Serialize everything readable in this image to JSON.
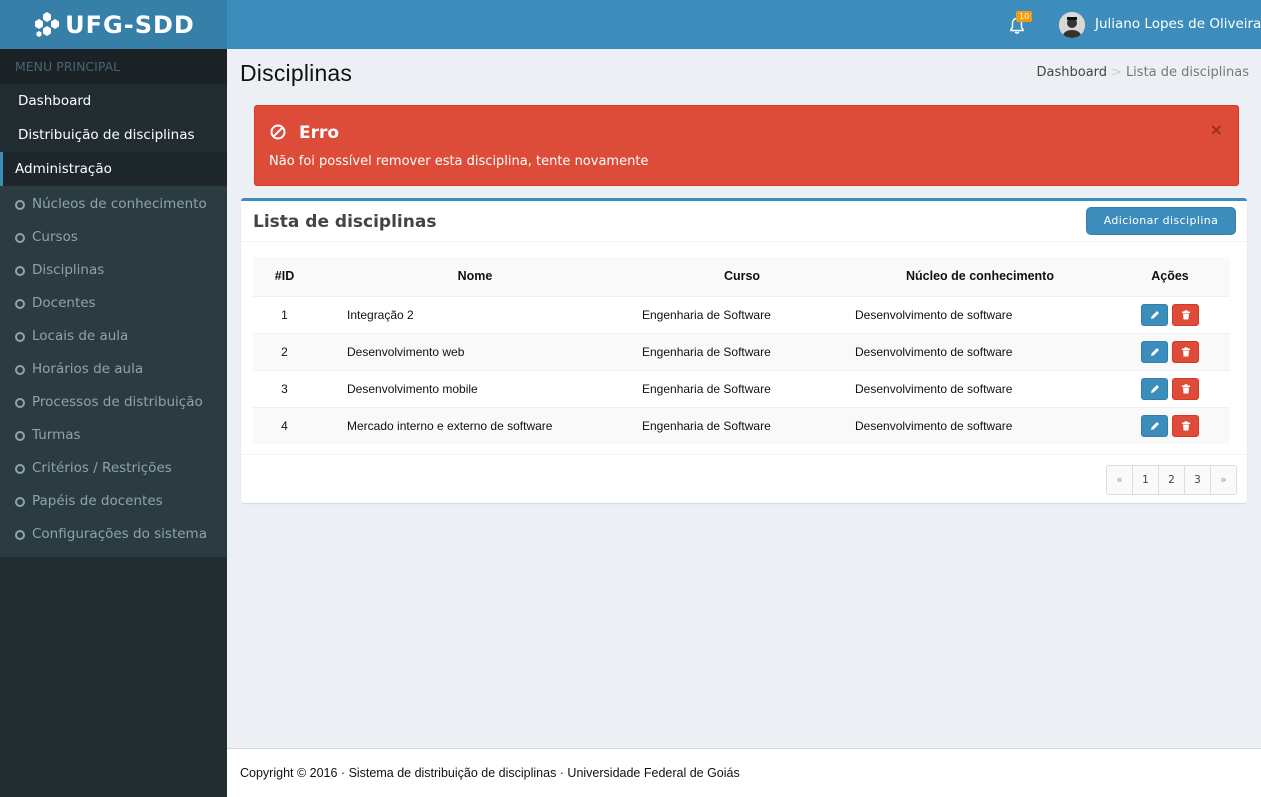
{
  "app": {
    "title": "UFG-SDD"
  },
  "sidebar": {
    "header": "MENU PRINCIPAL",
    "items": [
      {
        "label": "Dashboard"
      },
      {
        "label": "Distribuição de disciplinas"
      },
      {
        "label": "Administração"
      }
    ],
    "sub_items": [
      {
        "label": "Núcleos de conhecimento"
      },
      {
        "label": "Cursos"
      },
      {
        "label": "Disciplinas"
      },
      {
        "label": "Docentes"
      },
      {
        "label": "Locais de aula"
      },
      {
        "label": "Horários de aula"
      },
      {
        "label": "Processos de distribuição"
      },
      {
        "label": "Turmas"
      },
      {
        "label": "Critérios / Restrições"
      },
      {
        "label": "Papéis de docentes"
      },
      {
        "label": "Configurações do sistema"
      }
    ]
  },
  "header": {
    "notification_count": "10",
    "user_name": "Juliano Lopes de Oliveira"
  },
  "page": {
    "title": "Disciplinas",
    "breadcrumb": {
      "home": "Dashboard",
      "separator": ">",
      "current": "Lista de disciplinas"
    }
  },
  "alert": {
    "title": "Erro",
    "message": "Não foi possível remover esta disciplina, tente novamente",
    "close": "×"
  },
  "box": {
    "title": "Lista de disciplinas",
    "add_button": "Adicionar disciplina"
  },
  "table": {
    "headers": {
      "id": "#ID",
      "nome": "Nome",
      "curso": "Curso",
      "nucleo": "Núcleo de conhecimento",
      "acoes": "Ações"
    },
    "rows": [
      {
        "id": "1",
        "nome": "Integração 2",
        "curso": "Engenharia de Software",
        "nucleo": "Desenvolvimento de software"
      },
      {
        "id": "2",
        "nome": "Desenvolvimento web",
        "curso": "Engenharia de Software",
        "nucleo": "Desenvolvimento de software"
      },
      {
        "id": "3",
        "nome": "Desenvolvimento mobile",
        "curso": "Engenharia de Software",
        "nucleo": "Desenvolvimento de software"
      },
      {
        "id": "4",
        "nome": "Mercado interno e externo de software",
        "curso": "Engenharia de Software",
        "nucleo": "Desenvolvimento de software"
      }
    ]
  },
  "pagination": {
    "prev": "«",
    "pages": [
      "1",
      "2",
      "3"
    ],
    "next": "»"
  },
  "footer": {
    "text": "Copyright © 2016 · Sistema de distribuição de disciplinas · Universidade Federal de Goiás"
  },
  "colors": {
    "primary": "#3c8dbc",
    "danger": "#dd4b39",
    "sidebar": "#222d32",
    "warning": "#f39c12"
  }
}
